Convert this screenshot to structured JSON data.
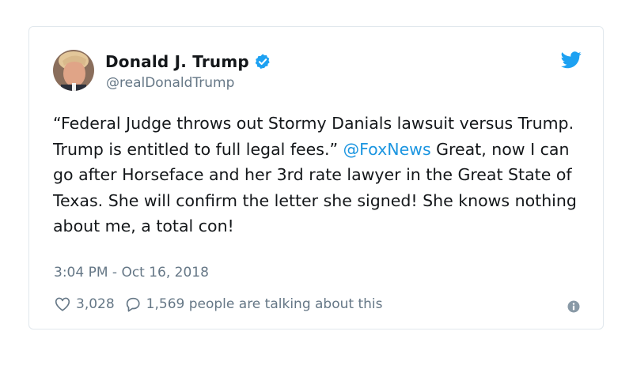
{
  "tweet": {
    "author": {
      "display_name": "Donald J. Trump",
      "handle": "@realDonaldTrump",
      "verified": true
    },
    "text_before_mention": "“Federal Judge throws out Stormy Danials lawsuit versus Trump. Trump is entitled to full legal fees.” ",
    "mention": "@FoxNews",
    "text_after_mention": " Great, now I can go after Horseface and her 3rd rate lawyer in the Great State of Texas. She will confirm the letter she signed! She knows nothing about me, a total con!",
    "timestamp": "3:04 PM - Oct 16, 2018",
    "like_count": "3,028",
    "talking_text": "1,569 people are talking about this"
  },
  "colors": {
    "link": "#1b95e0",
    "muted": "#657786",
    "verified_badge": "#1da1f2",
    "twitter_brand": "#1da1f2"
  },
  "icons": [
    "verified-badge-icon",
    "twitter-bird-icon",
    "heart-icon",
    "reply-bubble-icon",
    "info-icon"
  ]
}
